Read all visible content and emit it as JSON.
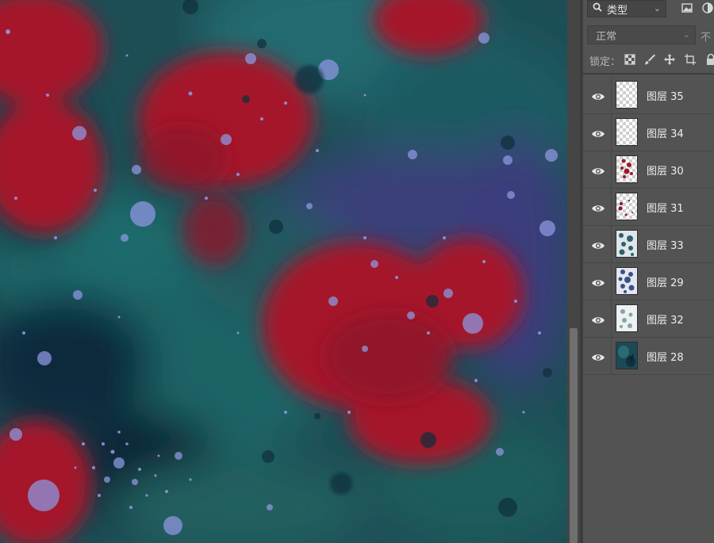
{
  "layers_panel": {
    "filter": {
      "icon": "search-icon",
      "label": "类型",
      "chevron": "⌄"
    },
    "blend_mode": {
      "label": "正常",
      "chevron": "⌄"
    },
    "opacity_label": "不",
    "lock": {
      "label": "锁定：",
      "icons": [
        "lock-transparent-pixels-icon",
        "lock-image-pixels-icon",
        "lock-position-icon",
        "lock-artboard-icon",
        "lock-all-icon"
      ]
    },
    "layers": [
      {
        "name": "图层 35",
        "visible": true,
        "thumbnail": "transparent"
      },
      {
        "name": "图层 34",
        "visible": true,
        "thumbnail": "transparent"
      },
      {
        "name": "图层 30",
        "visible": true,
        "thumbnail": "red-dots"
      },
      {
        "name": "图层 31",
        "visible": true,
        "thumbnail": "red-dots-sparse"
      },
      {
        "name": "图层 33",
        "visible": true,
        "thumbnail": "blue-texture"
      },
      {
        "name": "图层 29",
        "visible": true,
        "thumbnail": "blue-texture-dense"
      },
      {
        "name": "图层 32",
        "visible": true,
        "thumbnail": "blue-texture-light"
      },
      {
        "name": "图层 28",
        "visible": true,
        "thumbnail": "dark-teal"
      }
    ]
  },
  "colors": {
    "canvas_background": "#1c4f57",
    "poppy_red": "#a8182a",
    "spatter_blue": "#8f97e0",
    "panel_background": "#535353"
  }
}
